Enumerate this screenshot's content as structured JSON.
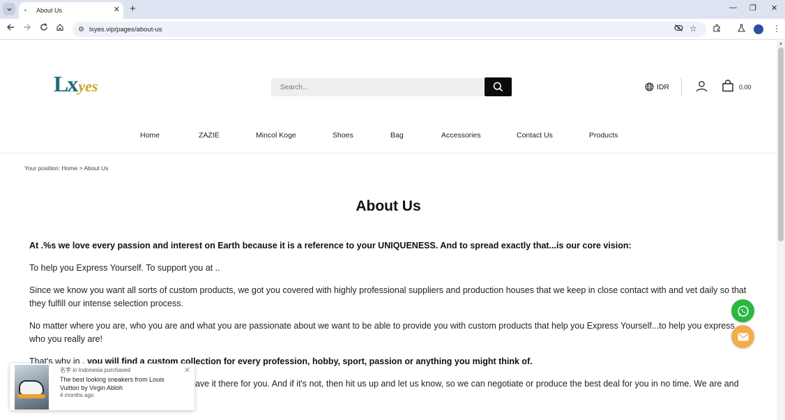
{
  "browser": {
    "tab_title": "About Us",
    "url": "lxyes.vip/pages/about-us"
  },
  "header": {
    "logo_main": "Lx",
    "logo_accent": "yes",
    "search_placeholder": "Search...",
    "currency": "IDR",
    "cart_total": "0.00"
  },
  "nav": {
    "items": [
      {
        "label": "Home"
      },
      {
        "label": "ZAZIE"
      },
      {
        "label": "Mincol Koge"
      },
      {
        "label": "Shoes"
      },
      {
        "label": "Bag"
      },
      {
        "label": "Accessories"
      },
      {
        "label": "Contact Us"
      },
      {
        "label": "Products"
      }
    ]
  },
  "breadcrumb": "Your position: Home > About Us",
  "page": {
    "title": "About Us",
    "paragraphs": [
      "At .%s we love every passion and interest on Earth because it is a reference to your UNIQUENESS. And to spread exactly that...is our core vision:",
      "To help you Express Yourself. To support you at ..",
      "Since we know you want all sorts of custom products, we got you covered with highly professional suppliers and production houses that we keep in close contact with and vet daily so that they fulfill our intense selection process.",
      "No matter where you are, who you are and what you are passionate about we want to be able to provide you with custom products that help you Express Yourself...to help you express who you really are!",
      "That's why in .",
      "you will find a custom collection for every profession, hobby, sport, passion or anything you might think of.",
      "have it there for you. And if it's not, then hit us up and let us know, so we can negotiate or produce the best deal for you in no time. We are and"
    ]
  },
  "popup": {
    "who": "名字 in Indonesia purchased",
    "product": "The best looking sneakers from Louis Vuitton by Virgin Abloh",
    "ago": "4 months ago"
  },
  "colors": {
    "whatsapp": "#2bb741",
    "mail": "#f2ac4b",
    "logo_teal": "#1f6c7c",
    "logo_gold": "#c9a224"
  }
}
